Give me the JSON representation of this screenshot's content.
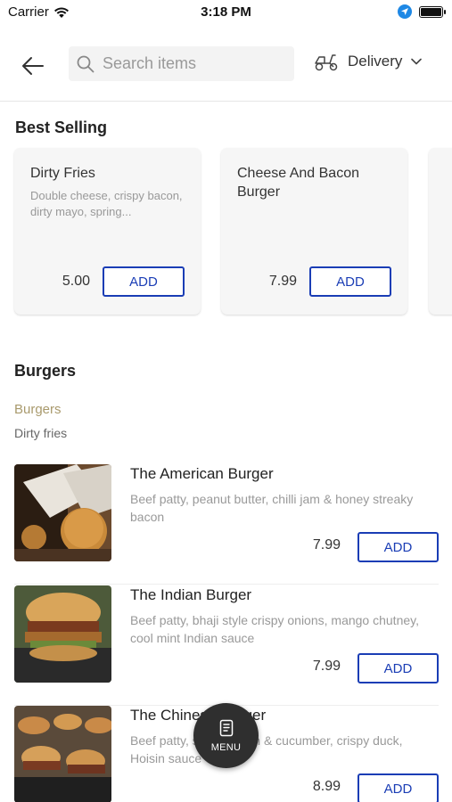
{
  "status": {
    "carrier": "Carrier",
    "time": "3:18 PM"
  },
  "header": {
    "search_placeholder": "Search items",
    "delivery_label": "Delivery"
  },
  "best_selling": {
    "title": "Best Selling",
    "items": [
      {
        "name": "Dirty Fries",
        "description": "Double cheese, crispy bacon, dirty mayo, spring...",
        "price": "5.00",
        "add_label": "ADD"
      },
      {
        "name": "Cheese And Bacon Burger",
        "description": "",
        "price": "7.99",
        "add_label": "ADD"
      }
    ]
  },
  "category": {
    "title": "Burgers",
    "subcategories": [
      "Burgers",
      "Dirty fries"
    ],
    "items": [
      {
        "name": "The American Burger",
        "description": "Beef patty, peanut butter, chilli jam & honey streaky bacon",
        "price": "7.99",
        "add_label": "ADD"
      },
      {
        "name": "The Indian Burger",
        "description": "Beef patty, bhaji style crispy onions, mango chutney, cool mint Indian sauce",
        "price": "7.99",
        "add_label": "ADD"
      },
      {
        "name": "The Chinese Burger",
        "description": "Beef patty, spring onion & cucumber, crispy duck, Hoisin sauce",
        "price": "8.99",
        "add_label": "ADD"
      }
    ]
  },
  "menu_fab": {
    "label": "MENU"
  },
  "colors": {
    "accent": "#1a3db5",
    "subcategory_active": "#a99a6d"
  }
}
